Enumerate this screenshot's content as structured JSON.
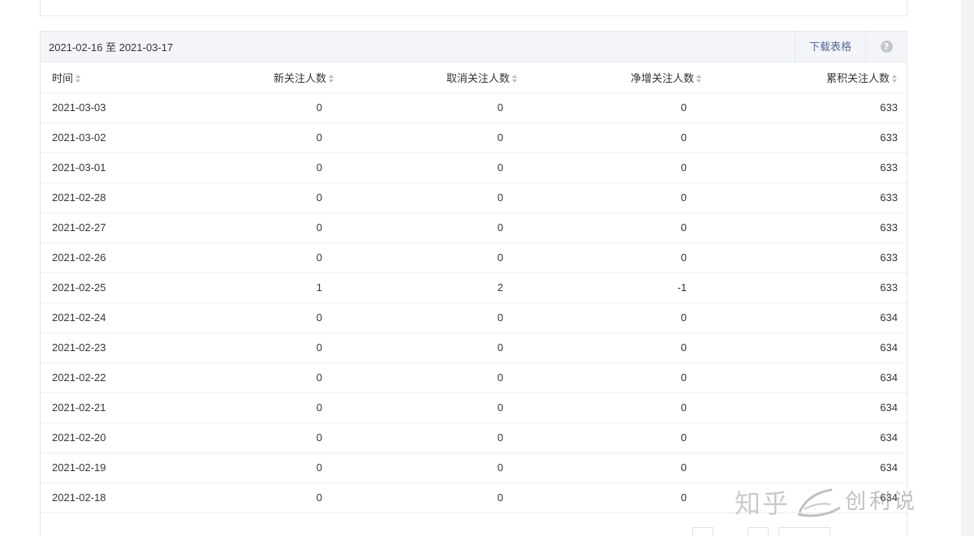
{
  "header": {
    "date_range": "2021-02-16 至 2021-03-17",
    "download_label": "下载表格",
    "help_icon": "question-circle-icon"
  },
  "columns": [
    "时间",
    "新关注人数",
    "取消关注人数",
    "净增关注人数",
    "累积关注人数"
  ],
  "rows": [
    [
      "2021-03-03",
      "0",
      "0",
      "0",
      "633"
    ],
    [
      "2021-03-02",
      "0",
      "0",
      "0",
      "633"
    ],
    [
      "2021-03-01",
      "0",
      "0",
      "0",
      "633"
    ],
    [
      "2021-02-28",
      "0",
      "0",
      "0",
      "633"
    ],
    [
      "2021-02-27",
      "0",
      "0",
      "0",
      "633"
    ],
    [
      "2021-02-26",
      "0",
      "0",
      "0",
      "633"
    ],
    [
      "2021-02-25",
      "1",
      "2",
      "-1",
      "633"
    ],
    [
      "2021-02-24",
      "0",
      "0",
      "0",
      "634"
    ],
    [
      "2021-02-23",
      "0",
      "0",
      "0",
      "634"
    ],
    [
      "2021-02-22",
      "0",
      "0",
      "0",
      "634"
    ],
    [
      "2021-02-21",
      "0",
      "0",
      "0",
      "634"
    ],
    [
      "2021-02-20",
      "0",
      "0",
      "0",
      "634"
    ],
    [
      "2021-02-19",
      "0",
      "0",
      "0",
      "634"
    ],
    [
      "2021-02-18",
      "0",
      "0",
      "0",
      "634"
    ]
  ],
  "watermark": {
    "zhihu": "知乎",
    "brand": "创利说"
  },
  "colors": {
    "link": "#576b95",
    "header_bg": "#f4f5f9",
    "border": "#e4e8eb"
  }
}
